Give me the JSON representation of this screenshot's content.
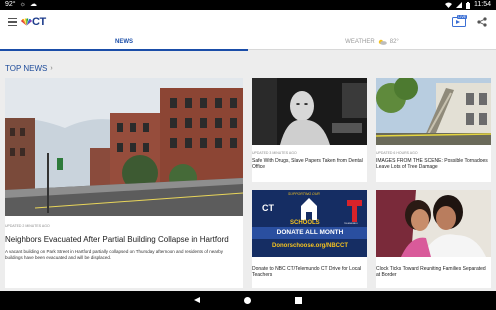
{
  "status_bar": {
    "left_items": [
      "92°",
      "☼",
      "☁"
    ],
    "time": "11:54"
  },
  "app_bar": {
    "logo_text": "CT",
    "live_badge": "LIVE"
  },
  "tabs": {
    "news": "NEWS",
    "weather_label": "WEATHER",
    "weather_temp": "82°"
  },
  "section": {
    "title": "TOP NEWS",
    "chevron": "›"
  },
  "hero": {
    "meta": "UPDATED 2 MINUTES AGO",
    "headline": "Neighbors Evacuated After Partial Building Collapse in Hartford",
    "summary": "A vacant building on Park Street in Hartford partially collapsed on Thursday afternoon and residents of nearby buildings have been evacuated and will be displaced."
  },
  "cards": [
    {
      "meta": "UPDATED 3 MINUTES AGO",
      "headline": "Safe With Drugs, Slave Papers Taken from Dental Office"
    },
    {
      "meta": "UPDATED 6 HOURS AGO",
      "headline": "IMAGES FROM THE SCENE: Possible Tornadoes Leave Lots of Tree Damage"
    },
    {
      "meta": "",
      "headline": "Donate to NBC CT/Telemundo CT Drive for Local Teachers"
    },
    {
      "meta": "",
      "headline": "Clock Ticks Toward Reuniting Families Separated at Border"
    }
  ],
  "promo_graphic": {
    "line1": "SUPPORTING OUR",
    "line2": "SCHOOLS",
    "line3": "DONATE ALL MONTH",
    "line4": "Donorschoose.org/NBCCT",
    "brand": "CT",
    "brand2": "TELEMUNDO"
  },
  "colors": {
    "accent": "#1a4da8",
    "status_bar": "#000000",
    "page_bg": "#ededed"
  }
}
